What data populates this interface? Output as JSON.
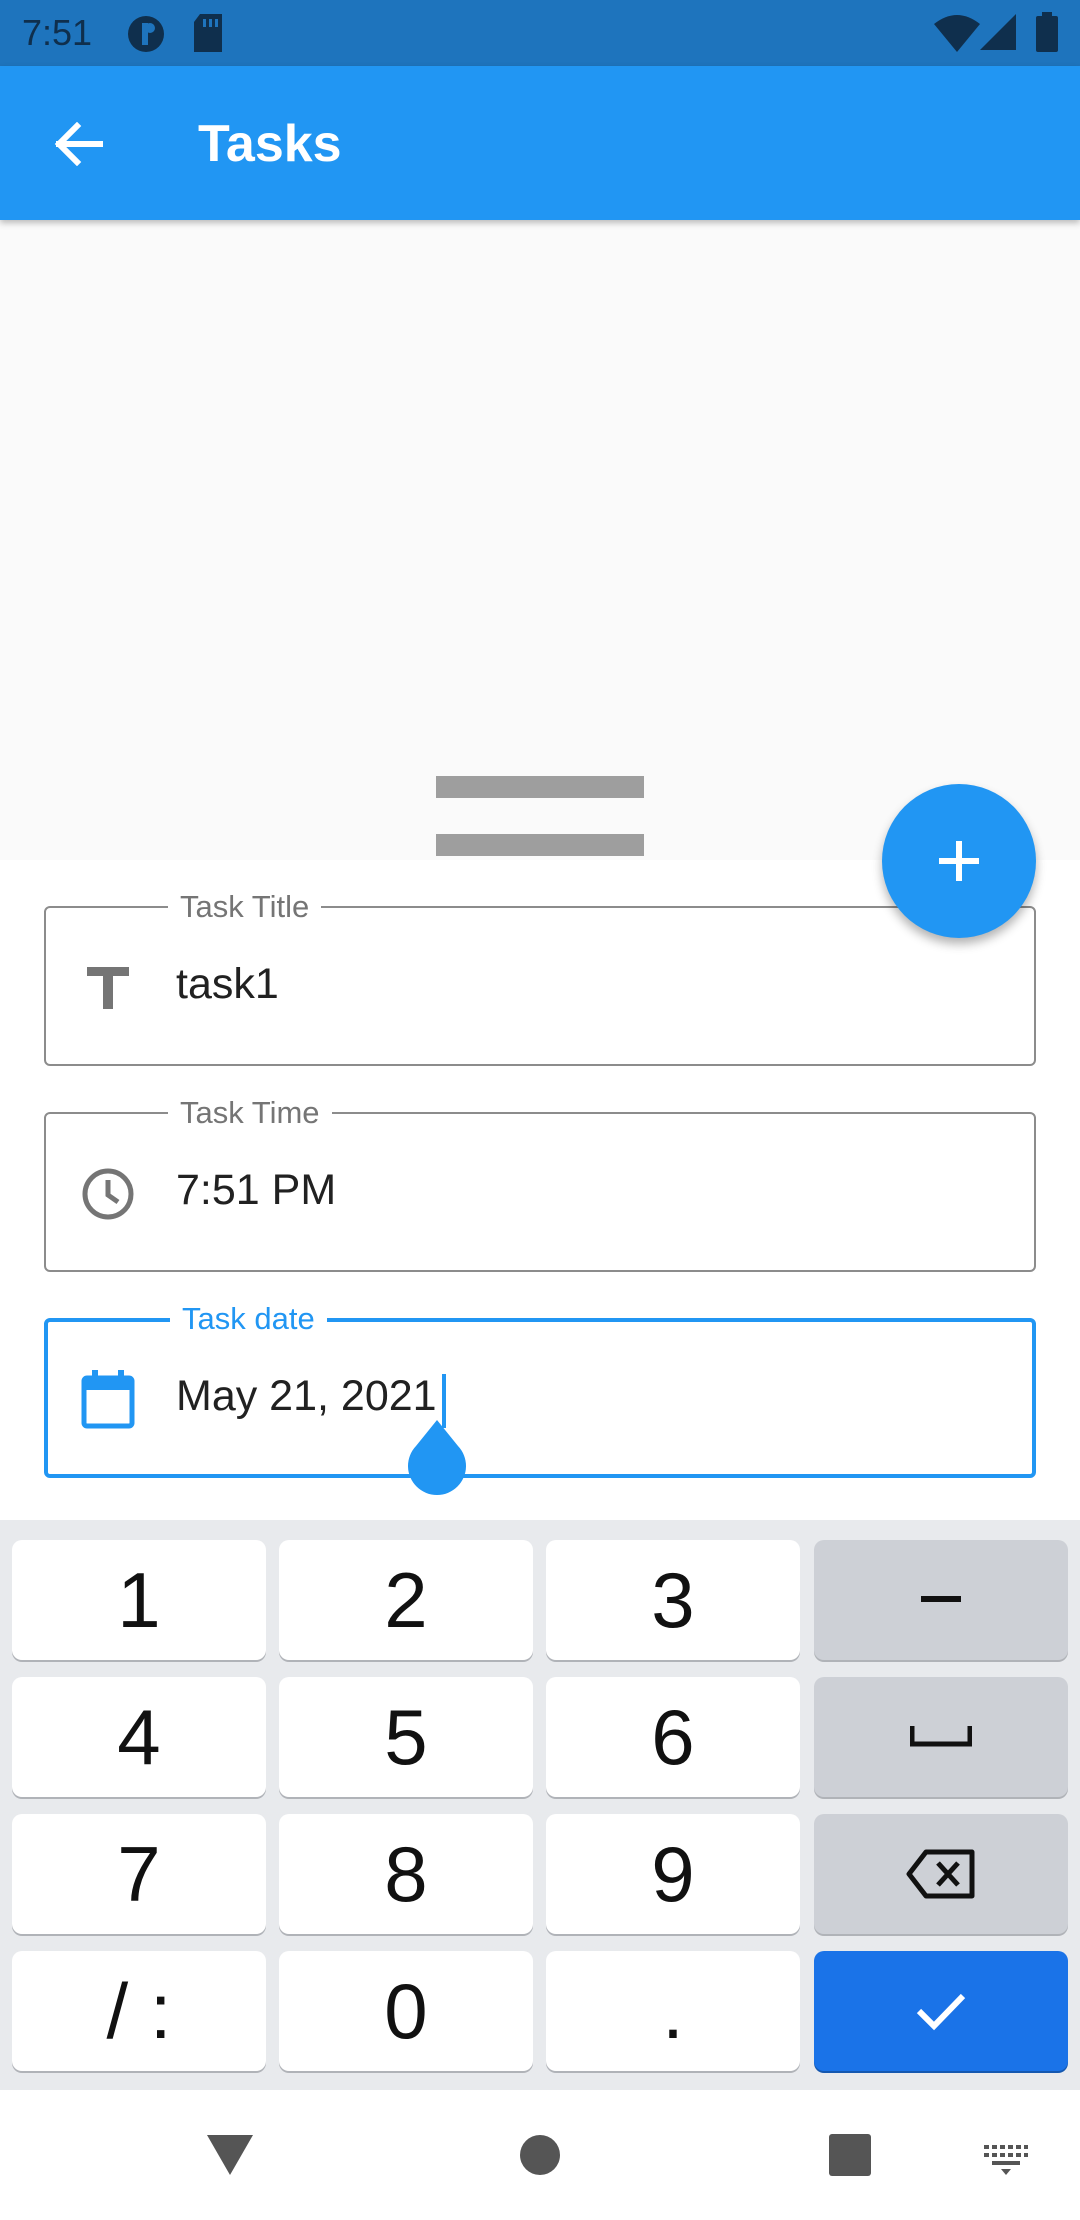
{
  "status_bar": {
    "time": "7:51",
    "icons": [
      "notification-icon",
      "sd-card-icon",
      "wifi-icon",
      "signal-icon",
      "battery-icon"
    ]
  },
  "app_bar": {
    "title": "Tasks",
    "back_icon": "arrow-back-icon"
  },
  "form": {
    "task_title": {
      "label": "Task Title",
      "value": "task1",
      "icon": "text-title-icon"
    },
    "task_time": {
      "label": "Task Time",
      "value": "7:51 PM",
      "icon": "clock-icon"
    },
    "task_date": {
      "label": "Task date",
      "value": "May 21, 2021",
      "icon": "calendar-icon",
      "focused": true
    }
  },
  "fab": {
    "icon": "plus-icon"
  },
  "keyboard": {
    "rows": [
      [
        "1",
        "2",
        "3",
        "-"
      ],
      [
        "4",
        "5",
        "6",
        "space"
      ],
      [
        "7",
        "8",
        "9",
        "backspace"
      ],
      [
        "/ :",
        "0",
        ".",
        "done"
      ]
    ]
  },
  "nav_bar": {
    "icons": [
      "back-triangle-icon",
      "home-circle-icon",
      "recents-square-icon",
      "keyboard-switch-icon"
    ]
  },
  "colors": {
    "primary": "#2196f3",
    "status_bar": "#1e74bd",
    "keyboard_action": "#1a73e8"
  }
}
